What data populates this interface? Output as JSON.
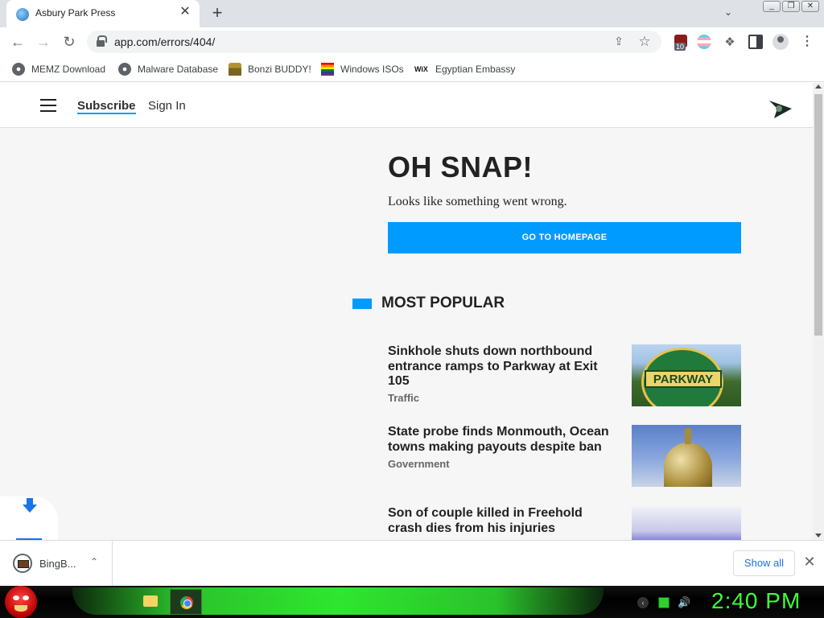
{
  "browser": {
    "tab": {
      "title": "Asbury Park Press",
      "close": "✕"
    },
    "new_tab": "+",
    "window_controls": [
      "_",
      "❐",
      "✕"
    ],
    "nav": {
      "back": "←",
      "forward": "→",
      "reload": "↻"
    },
    "url": "app.com/errors/404/",
    "extension_badge_count": "10",
    "bookmarks": [
      {
        "label": "MEMZ Download",
        "icon": "globe-icon"
      },
      {
        "label": "Malware Database",
        "icon": "globe-icon"
      },
      {
        "label": "Bonzi BUDDY!",
        "icon": "bonzi-icon"
      },
      {
        "label": "Windows ISOs",
        "icon": "rainbow-flag-icon"
      },
      {
        "label": "Egyptian Embassy",
        "icon": "wix-icon",
        "icon_text": "WiX"
      }
    ]
  },
  "site": {
    "subscribe": "Subscribe",
    "sign_in": "Sign In",
    "error_title": "OH SNAP!",
    "error_text": "Looks like something went wrong.",
    "home_button": "GO TO HOMEPAGE",
    "most_popular": "MOST POPULAR",
    "stories": [
      {
        "headline": "Sinkhole shuts down northbound entrance ramps to Parkway at Exit 105",
        "category": "Traffic",
        "thumb_text": "PARKWAY"
      },
      {
        "headline": "State probe finds Monmouth, Ocean towns making payouts despite ban",
        "category": "Government"
      },
      {
        "headline": "Son of couple killed in Freehold crash dies from his injuries",
        "category": ""
      }
    ],
    "accent_color": "#009bff"
  },
  "download_shelf": {
    "file_name": "BingB...",
    "show_all": "Show all",
    "close": "✕"
  },
  "taskbar": {
    "clock": "2:40 PM",
    "clock_color": "#3dff3d"
  }
}
